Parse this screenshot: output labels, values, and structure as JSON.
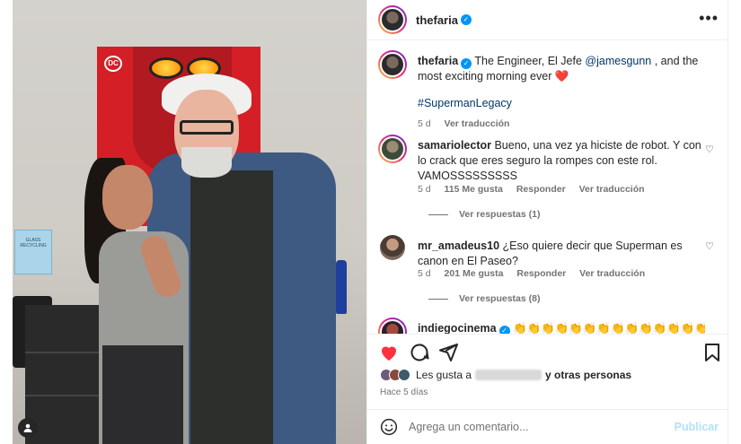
{
  "post": {
    "username": "thefaria",
    "more_icon": "more-horizontal-icon"
  },
  "caption": {
    "username": "thefaria",
    "text_before": "The Engineer, El Jefe ",
    "mention": "@jamesgunn",
    "text_after": " , and the most exciting morning ever ❤️",
    "hashtag": "#SupermanLegacy",
    "age": "5 d",
    "translate": "Ver traducción"
  },
  "comments": [
    {
      "username": "samariolector",
      "text": "Bueno, una vez ya hiciste de robot. Y con lo crack que eres seguro la rompes con este rol. VAMOSSSSSSSSS",
      "age": "5 d",
      "likes": "115 Me gusta",
      "reply": "Responder",
      "translate": "Ver traducción",
      "view_replies": "Ver respuestas (1)"
    },
    {
      "username": "mr_amadeus10",
      "text": "¿Eso quiere decir que Superman es canon en El Paseo?",
      "age": "5 d",
      "likes": "201 Me gusta",
      "reply": "Responder",
      "translate": "Ver traducción",
      "view_replies": "Ver respuestas (8)"
    },
    {
      "username": "indiegocinema",
      "text": "👏👏👏👏👏👏👏👏👏👏👏👏👏👏👏👏👏👏👏"
    }
  ],
  "likes_line": {
    "prefix": "Les gusta a",
    "suffix": "y otras personas"
  },
  "timestamp": "Hace 5 días",
  "composer": {
    "placeholder": "Agrega un comentario...",
    "publish": "Publicar"
  },
  "photo_poster_logo": "DC",
  "photo_sign_text": "GLASS RECYCLING",
  "colors": {
    "like_red": "#ff3040",
    "verified_blue": "#0095f6",
    "link_blue": "#00376b",
    "publish_disabled": "#b2dffc"
  }
}
